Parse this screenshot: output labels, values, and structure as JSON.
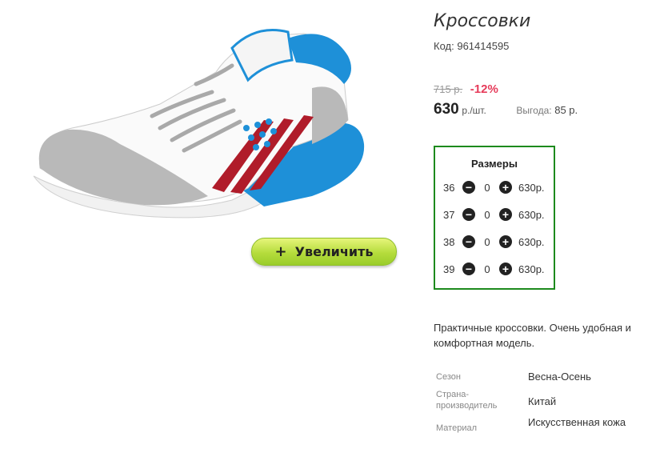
{
  "product": {
    "title": "Кроссовки",
    "code_label": "Код:",
    "code": "961414595",
    "old_price": "715 р.",
    "discount": "-12%",
    "price": "630",
    "price_unit": "р./шт.",
    "savings_label": "Выгода:",
    "savings_value": "85 р.",
    "zoom_button": {
      "icon": "plus",
      "label": "Увеличить"
    },
    "sizes": {
      "title": "Размеры",
      "rows": [
        {
          "size": "36",
          "qty": "0",
          "price": "630р."
        },
        {
          "size": "37",
          "qty": "0",
          "price": "630р."
        },
        {
          "size": "38",
          "qty": "0",
          "price": "630р."
        },
        {
          "size": "39",
          "qty": "0",
          "price": "630р."
        }
      ]
    },
    "description": "Практичные кроссовки. Очень удобная и комфортная модель.",
    "properties": [
      {
        "label": "Сезон",
        "value": "Весна-Осень"
      },
      {
        "label": "Страна-производитель",
        "value": "Китай"
      },
      {
        "label": "Материал",
        "value": "Искусственная кожа"
      }
    ]
  },
  "colors": {
    "discount": "#e63b5a",
    "sizes_border": "#1d8a1d",
    "zoom_button": "#b5dc3c",
    "shoe_blue": "#1e90d8",
    "shoe_red": "#b01c2a",
    "shoe_grey": "#b9b9b9"
  }
}
